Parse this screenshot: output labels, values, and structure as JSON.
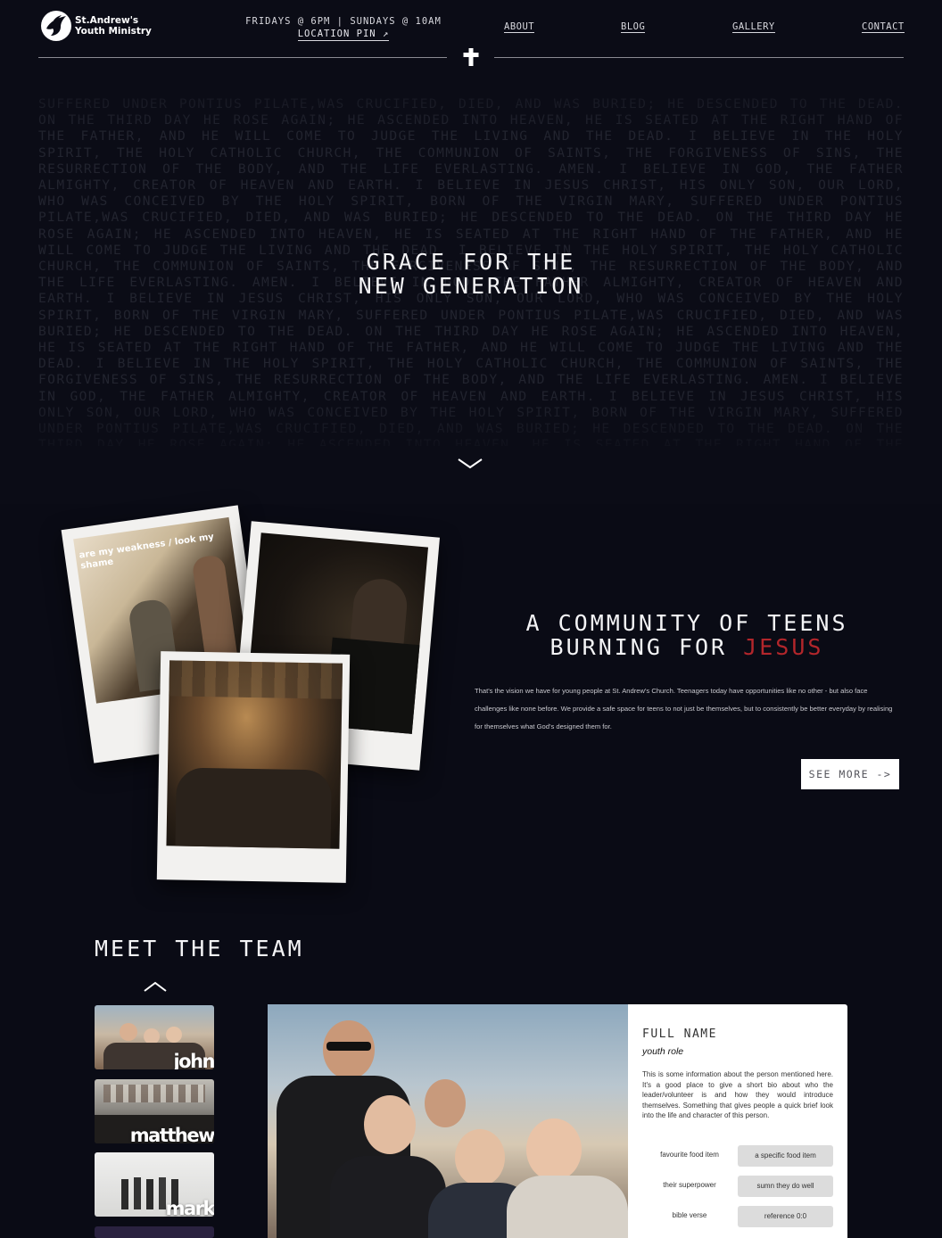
{
  "header": {
    "logo_line1": "St.Andrew's",
    "logo_line2": "Youth Ministry",
    "service_times": "FRIDAYS @ 6PM | SUNDAYS @ 10AM",
    "location_label": "LOCATION PIN ↗",
    "nav": [
      "ABOUT",
      "BLOG",
      "GALLERY",
      "CONTACT"
    ],
    "icons": {
      "logo": "dove-icon",
      "divider": "cross-icon"
    }
  },
  "hero": {
    "creed": "SUFFERED UNDER PONTIUS PILATE,WAS CRUCIFIED, DIED, AND WAS BURIED; HE DESCENDED TO THE DEAD. ON THE THIRD DAY HE ROSE AGAIN; HE ASCENDED INTO HEAVEN, HE IS SEATED AT THE RIGHT HAND OF THE FATHER, AND HE WILL COME TO JUDGE THE LIVING AND THE DEAD. I BELIEVE IN THE HOLY SPIRIT, THE HOLY CATHOLIC CHURCH, THE COMMUNION OF SAINTS, THE FORGIVENESS OF SINS, THE RESURRECTION OF THE BODY, AND THE LIFE EVERLASTING. AMEN. I BELIEVE IN GOD, THE FATHER ALMIGHTY, CREATOR OF HEAVEN AND EARTH. I BELIEVE IN JESUS CHRIST, HIS ONLY SON, OUR LORD, WHO WAS CONCEIVED BY THE HOLY SPIRIT, BORN OF THE VIRGIN MARY, SUFFERED UNDER PONTIUS PILATE,WAS CRUCIFIED, DIED, AND WAS BURIED; HE DESCENDED TO THE DEAD. ON THE THIRD DAY HE ROSE AGAIN; HE ASCENDED INTO HEAVEN, HE IS SEATED AT THE RIGHT HAND OF THE FATHER, AND HE WILL COME TO JUDGE THE LIVING AND THE DEAD. I BELIEVE IN THE HOLY SPIRIT, THE HOLY CATHOLIC CHURCH, THE COMMUNION OF SAINTS, THE FORGIVENESS OF SINS, THE RESURRECTION OF THE BODY, AND THE LIFE EVERLASTING. AMEN. I BELIEVE IN GOD, THE FATHER ALMIGHTY, CREATOR OF HEAVEN AND EARTH. I BELIEVE IN JESUS CHRIST, HIS ONLY SON, OUR LORD, WHO WAS CONCEIVED BY THE HOLY SPIRIT, BORN OF THE VIRGIN MARY, SUFFERED UNDER PONTIUS PILATE,WAS CRUCIFIED, DIED, AND WAS BURIED; HE DESCENDED TO THE DEAD. ON THE THIRD DAY HE ROSE AGAIN; HE ASCENDED INTO HEAVEN, HE IS SEATED AT THE RIGHT HAND OF THE FATHER, AND HE WILL COME TO JUDGE THE LIVING AND THE DEAD. I BELIEVE IN THE HOLY SPIRIT, THE HOLY CATHOLIC CHURCH, THE COMMUNION OF SAINTS, THE FORGIVENESS OF SINS, THE RESURRECTION OF THE BODY, AND THE LIFE EVERLASTING. AMEN. I BELIEVE IN GOD, THE FATHER ALMIGHTY, CREATOR OF HEAVEN AND EARTH. I BELIEVE IN JESUS CHRIST, HIS ONLY SON, OUR LORD, WHO WAS CONCEIVED BY THE HOLY SPIRIT, BORN OF THE VIRGIN MARY, SUFFERED UNDER PONTIUS PILATE,WAS CRUCIFIED, DIED, AND WAS BURIED; HE DESCENDED TO THE DEAD. ON THE THIRD DAY HE ROSE AGAIN; HE ASCENDED INTO HEAVEN, HE IS SEATED AT THE RIGHT HAND OF THE FATHER, AND HE WILL COME TO JUDGE THE LIVING AND THE DEAD. I BELIEVE IN THE HOLY SPIRIT",
    "title_line1": "GRACE FOR THE",
    "title_line2": "NEW GENERATION",
    "icons": {
      "scroll": "chevron-down-icon"
    }
  },
  "community": {
    "title_line1": "A COMMUNITY OF TEENS",
    "title_line2_prefix": "BURNING FOR ",
    "title_accent": "JESUS",
    "accent_color": "#b3262b",
    "photo_caption": "are my weakness / look my shame",
    "body": "That's the vision we have for young people at St. Andrew's Church. Teenagers today have opportunities like no other - but also face challenges like none before. We provide a safe space for teens to not just be themselves, but to consistently be better everyday by realising for themselves what God's designed them for.",
    "button_label": "SEE MORE ->"
  },
  "team": {
    "title": "MEET THE TEAM",
    "thumbnails": [
      "john",
      "matthew",
      "mark"
    ],
    "icons": {
      "scroll_up": "chevron-up-icon"
    },
    "card": {
      "full_name": "FULL NAME",
      "role": "youth role",
      "bio": "This is some information about the person mentioned here. It's a good place to give a short bio about who the leader/volunteer is and how they would introduce themselves. Something that gives people a quick brief look into the life and character of this person.",
      "facts": [
        {
          "label": "favourite food item",
          "value": "a specific food item"
        },
        {
          "label": "their superpower",
          "value": "sumn they do well"
        },
        {
          "label": "bible verse",
          "value": "reference 0:0"
        }
      ]
    }
  }
}
